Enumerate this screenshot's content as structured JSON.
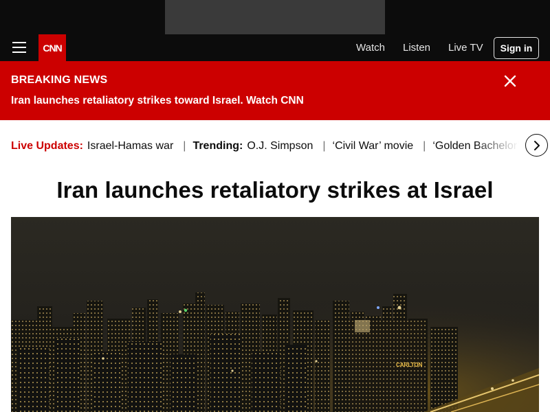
{
  "brand": {
    "logo_text": "CNN",
    "logo_color": "#cc0000"
  },
  "nav": {
    "links": [
      "Watch",
      "Listen",
      "Live TV"
    ],
    "signin_label": "Sign in"
  },
  "breaking": {
    "label": "BREAKING NEWS",
    "headline": "Iran launches retaliatory strikes toward Israel. Watch CNN",
    "background_color": "#cc0000"
  },
  "ticker": {
    "live_label": "Live Updates:",
    "live_items": [
      "Israel-Hamas war"
    ],
    "trending_label": "Trending:",
    "trending_items": [
      "O.J. Simpson",
      "‘Civil War’ movie",
      "‘Golden Bachelor’"
    ]
  },
  "article": {
    "headline": "Iran launches retaliatory strikes at Israel",
    "photo_sign_text": "CARLTON"
  },
  "icons": {
    "menu": "hamburger-menu-icon",
    "close": "close-icon",
    "next": "chevron-right-icon"
  }
}
